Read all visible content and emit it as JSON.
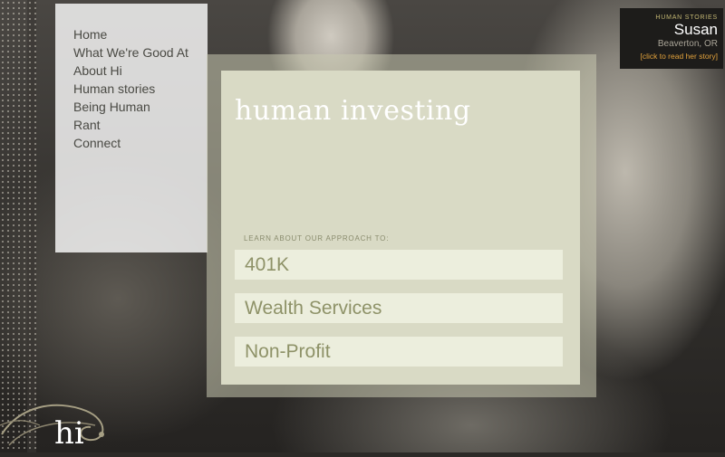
{
  "nav": {
    "items": [
      "Home",
      "What We're Good At",
      "About Hi",
      "Human stories",
      "Being Human",
      "Rant",
      "Connect"
    ]
  },
  "hero": {
    "title": "human investing",
    "learn_label": "LEARN ABOUT OUR APPROACH TO:",
    "options": [
      "401K",
      "Wealth Services",
      "Non-Profit"
    ]
  },
  "story": {
    "kicker": "HUMAN STORIES",
    "name": "Susan",
    "location": "Beaverton, OR",
    "cta": "[click to read her story]"
  },
  "logo": {
    "text": "hi"
  },
  "colors": {
    "panel": "#d9dac5",
    "button": "#eceedd",
    "button_text": "#8e9268",
    "accent": "#e2a23c"
  }
}
